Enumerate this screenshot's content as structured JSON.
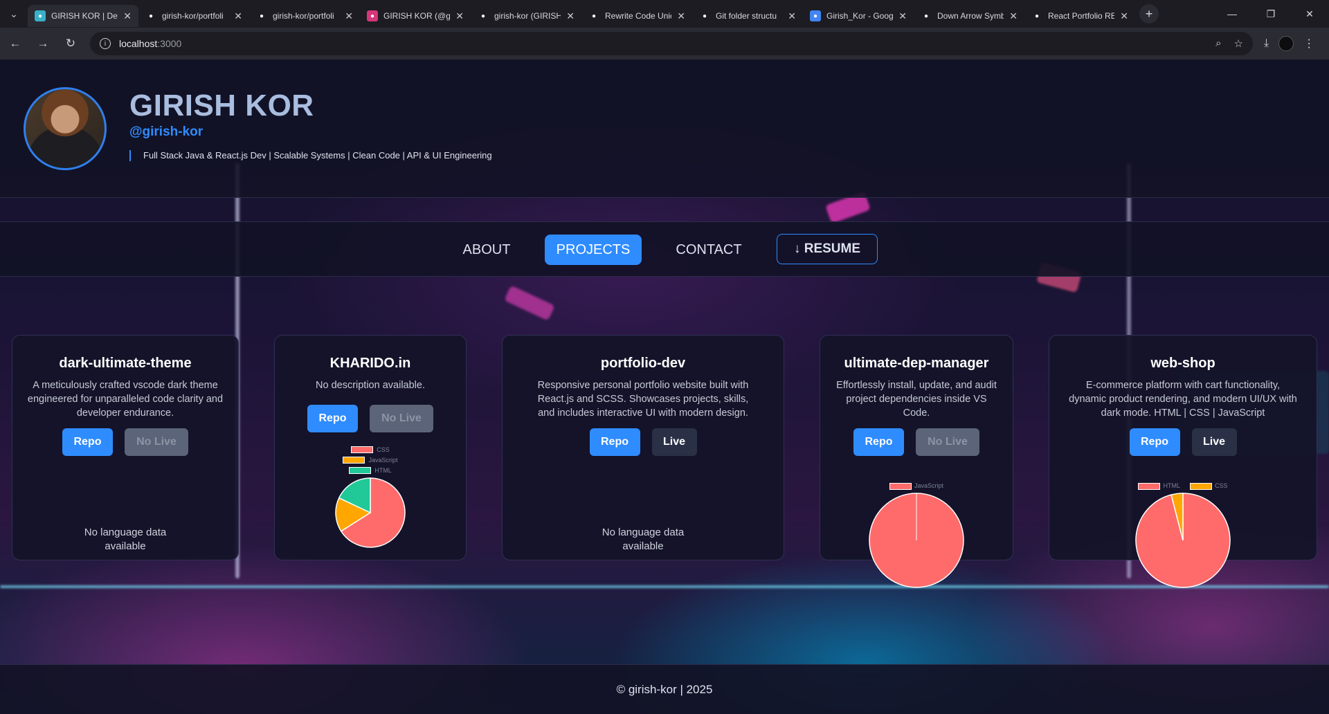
{
  "browser": {
    "tabs": [
      {
        "title": "GIRISH KOR | Dev",
        "icon": "site-icon",
        "color": "#3ab0c8"
      },
      {
        "title": "girish-kor/portfoli",
        "icon": "github-icon",
        "color": "#1c1c22"
      },
      {
        "title": "girish-kor/portfoli",
        "icon": "github-icon",
        "color": "#1c1c22"
      },
      {
        "title": "GIRISH KOR (@gi",
        "icon": "instagram-icon",
        "color": "#d6367a"
      },
      {
        "title": "girish-kor (GIRISH",
        "icon": "github-icon",
        "color": "#1c1c22"
      },
      {
        "title": "Rewrite Code Unic",
        "icon": "openai-icon",
        "color": "#1c1c22"
      },
      {
        "title": "Git folder structu",
        "icon": "openai-icon",
        "color": "#1c1c22"
      },
      {
        "title": "Girish_Kor - Goog",
        "icon": "docs-icon",
        "color": "#4285f4"
      },
      {
        "title": "Down Arrow Symb",
        "icon": "claude-icon",
        "color": "#1c1c22"
      },
      {
        "title": "React Portfolio RE",
        "icon": "openai-icon",
        "color": "#1c1c22"
      }
    ],
    "url_host": "localhost",
    "url_port": ":3000"
  },
  "header": {
    "name": "GIRISH KOR",
    "handle": "@girish-kor",
    "tagline": "Full Stack Java & React.js Dev | Scalable Systems | Clean Code | API & UI Engineering"
  },
  "nav": {
    "about": "ABOUT",
    "projects": "PROJECTS",
    "contact": "CONTACT",
    "resume": "↓ RESUME"
  },
  "projects": [
    {
      "title": "dark-ultimate-theme",
      "description": "A meticulously crafted vscode dark theme engineered for unparalleled code clarity and developer endurance.",
      "repo": "Repo",
      "live": "No Live",
      "has_live": false,
      "languages": [],
      "no_lang": "No language data available"
    },
    {
      "title": "KHARIDO.in",
      "description": "No description available.",
      "repo": "Repo",
      "live": "No Live",
      "has_live": false,
      "languages": [
        {
          "name": "CSS",
          "share": 0.66,
          "color": "#ff6b6b"
        },
        {
          "name": "JavaScript",
          "share": 0.16,
          "color": "#ffa600"
        },
        {
          "name": "HTML",
          "share": 0.18,
          "color": "#20c997"
        }
      ]
    },
    {
      "title": "portfolio-dev",
      "description": "Responsive personal portfolio website built with React.js and SCSS. Showcases projects, skills, and includes interactive UI with modern design.",
      "repo": "Repo",
      "live": "Live",
      "has_live": true,
      "languages": [],
      "no_lang": "No language data available"
    },
    {
      "title": "ultimate-dep-manager",
      "description": "Effortlessly install, update, and audit project dependencies inside VS Code.",
      "repo": "Repo",
      "live": "No Live",
      "has_live": false,
      "languages": [
        {
          "name": "JavaScript",
          "share": 1.0,
          "color": "#ff6b6b"
        }
      ]
    },
    {
      "title": "web-shop",
      "description": "E-commerce platform with cart functionality, dynamic product rendering, and modern UI/UX with dark mode. HTML | CSS | JavaScript",
      "repo": "Repo",
      "live": "Live",
      "has_live": true,
      "languages": [
        {
          "name": "HTML",
          "share": 0.96,
          "color": "#ff6b6b"
        },
        {
          "name": "CSS",
          "share": 0.04,
          "color": "#ffa600"
        }
      ]
    }
  ],
  "footer": {
    "text": "© girish-kor | 2025"
  }
}
